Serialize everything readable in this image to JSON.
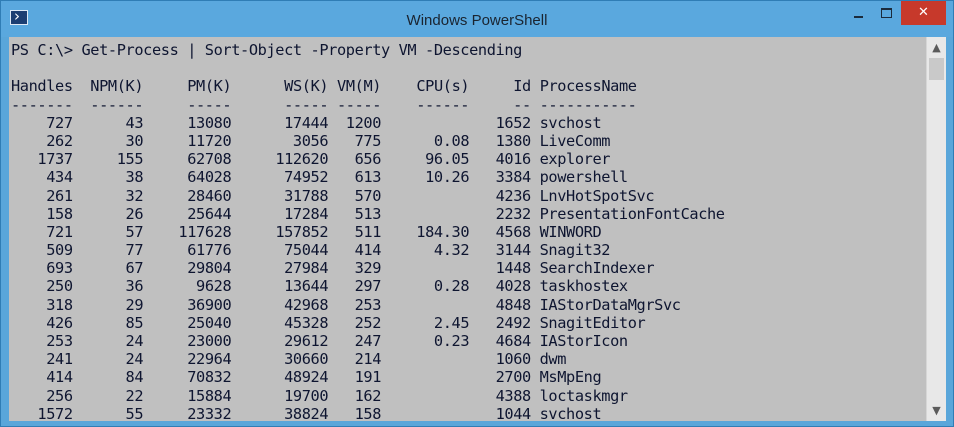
{
  "window": {
    "title": "Windows PowerShell",
    "close_glyph": "✕",
    "app_icon": "powershell-icon"
  },
  "console": {
    "command_line": "PS C:\\> Get-Process | Sort-Object -Property VM -Descending",
    "columns": [
      "Handles",
      "NPM(K)",
      "PM(K)",
      "WS(K)",
      "VM(M)",
      "CPU(s)",
      "Id",
      "ProcessName"
    ],
    "rows": [
      {
        "handles": "727",
        "npm": "43",
        "pm": "13080",
        "ws": "17444",
        "vm": "1200",
        "cpu": "",
        "id": "1652",
        "name": "svchost"
      },
      {
        "handles": "262",
        "npm": "30",
        "pm": "11720",
        "ws": "3056",
        "vm": "775",
        "cpu": "0.08",
        "id": "1380",
        "name": "LiveComm"
      },
      {
        "handles": "1737",
        "npm": "155",
        "pm": "62708",
        "ws": "112620",
        "vm": "656",
        "cpu": "96.05",
        "id": "4016",
        "name": "explorer"
      },
      {
        "handles": "434",
        "npm": "38",
        "pm": "64028",
        "ws": "74952",
        "vm": "613",
        "cpu": "10.26",
        "id": "3384",
        "name": "powershell"
      },
      {
        "handles": "261",
        "npm": "32",
        "pm": "28460",
        "ws": "31788",
        "vm": "570",
        "cpu": "",
        "id": "4236",
        "name": "LnvHotSpotSvc"
      },
      {
        "handles": "158",
        "npm": "26",
        "pm": "25644",
        "ws": "17284",
        "vm": "513",
        "cpu": "",
        "id": "2232",
        "name": "PresentationFontCache"
      },
      {
        "handles": "721",
        "npm": "57",
        "pm": "117628",
        "ws": "157852",
        "vm": "511",
        "cpu": "184.30",
        "id": "4568",
        "name": "WINWORD"
      },
      {
        "handles": "509",
        "npm": "77",
        "pm": "61776",
        "ws": "75044",
        "vm": "414",
        "cpu": "4.32",
        "id": "3144",
        "name": "Snagit32"
      },
      {
        "handles": "693",
        "npm": "67",
        "pm": "29804",
        "ws": "27984",
        "vm": "329",
        "cpu": "",
        "id": "1448",
        "name": "SearchIndexer"
      },
      {
        "handles": "250",
        "npm": "36",
        "pm": "9628",
        "ws": "13644",
        "vm": "297",
        "cpu": "0.28",
        "id": "4028",
        "name": "taskhostex"
      },
      {
        "handles": "318",
        "npm": "29",
        "pm": "36900",
        "ws": "42968",
        "vm": "253",
        "cpu": "",
        "id": "4848",
        "name": "IAStorDataMgrSvc"
      },
      {
        "handles": "426",
        "npm": "85",
        "pm": "25040",
        "ws": "45328",
        "vm": "252",
        "cpu": "2.45",
        "id": "2492",
        "name": "SnagitEditor"
      },
      {
        "handles": "253",
        "npm": "24",
        "pm": "23000",
        "ws": "29612",
        "vm": "247",
        "cpu": "0.23",
        "id": "4684",
        "name": "IAStorIcon"
      },
      {
        "handles": "241",
        "npm": "24",
        "pm": "22964",
        "ws": "30660",
        "vm": "214",
        "cpu": "",
        "id": "1060",
        "name": "dwm"
      },
      {
        "handles": "414",
        "npm": "84",
        "pm": "70832",
        "ws": "48924",
        "vm": "191",
        "cpu": "",
        "id": "2700",
        "name": "MsMpEng"
      },
      {
        "handles": "256",
        "npm": "22",
        "pm": "15884",
        "ws": "19700",
        "vm": "162",
        "cpu": "",
        "id": "4388",
        "name": "loctaskmgr"
      },
      {
        "handles": "1572",
        "npm": "55",
        "pm": "23332",
        "ws": "38824",
        "vm": "158",
        "cpu": "",
        "id": "1044",
        "name": "svchost"
      }
    ],
    "background": "#c0c0c0",
    "foreground": "#0e1530"
  },
  "scrollbar": {
    "up_icon": "scroll-up-arrow-icon",
    "down_icon": "scroll-down-arrow-icon"
  }
}
